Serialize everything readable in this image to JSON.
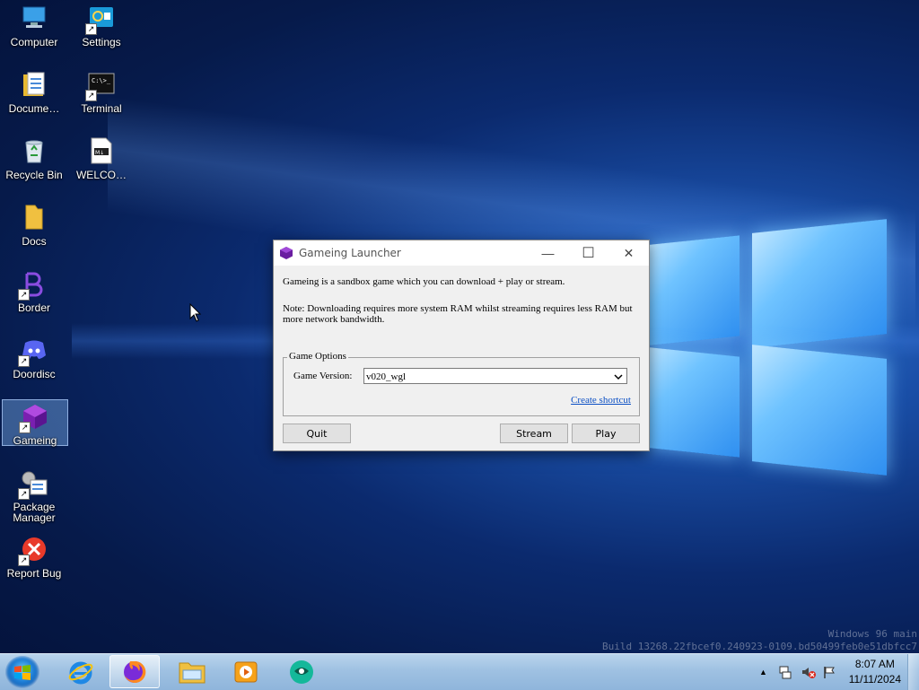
{
  "desktop": {
    "icons": [
      {
        "label": "Computer"
      },
      {
        "label": "Settings"
      },
      {
        "label": "Docume…"
      },
      {
        "label": "Terminal"
      },
      {
        "label": "Recycle Bin"
      },
      {
        "label": "WELCO…"
      },
      {
        "label": "Docs"
      },
      {
        "label": "Border"
      },
      {
        "label": "Doordisc"
      },
      {
        "label": "Gameing"
      },
      {
        "label": "Package Manager"
      },
      {
        "label": "Report Bug"
      }
    ],
    "watermark": {
      "line1": "Windows 96 main",
      "line2": "Build 13268.22fbcef0.240923-0109.bd50499feb0e51dbfcc7"
    }
  },
  "dialog": {
    "title": "Gameing Launcher",
    "description": "Gameing is a sandbox game which you can download + play or stream.",
    "note": "Note: Downloading requires more system RAM whilst streaming requires less RAM but more network bandwidth.",
    "group_label": "Game Options",
    "version_label": "Game Version:",
    "version_value": "v020_wgl",
    "create_shortcut": "Create shortcut",
    "quit": "Quit",
    "stream": "Stream",
    "play": "Play",
    "controls": {
      "minimize": "—",
      "maximize": "☐",
      "close": "✕"
    }
  },
  "taskbar": {
    "clock_time": "8:07 AM",
    "clock_date": "11/11/2024",
    "tray_arrow": "▲"
  },
  "colors": {
    "accent": "#0b4fc4",
    "selection": "#78aae6"
  }
}
